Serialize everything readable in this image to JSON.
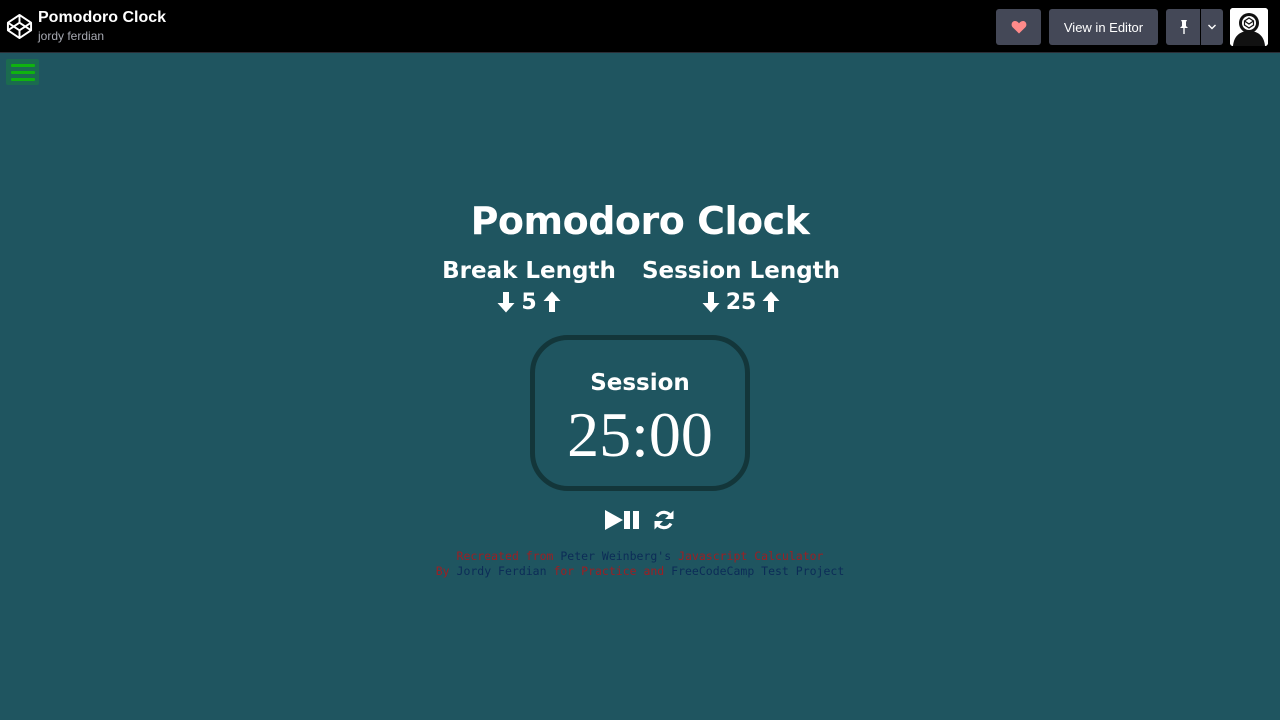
{
  "header": {
    "title": "Pomodoro Clock",
    "author": "jordy ferdian",
    "view_editor_label": "View in Editor"
  },
  "icons": {
    "logo": "codepen-logo-icon",
    "heart": "heart-icon",
    "pin": "pin-icon",
    "dropdown": "chevron-down-icon",
    "menu": "hamburger-menu-icon",
    "down": "arrow-down-icon",
    "up": "arrow-up-icon",
    "playpause": "play-pause-icon",
    "reset": "refresh-icon"
  },
  "colors": {
    "background": "#1f5560",
    "topbar": "#000000",
    "button": "#444857",
    "heart": "#ff8a8a",
    "timer_border": "#13363a",
    "credit_red": "#9c1f23",
    "credit_blue": "#0c2c57"
  },
  "clock": {
    "title": "Pomodoro Clock",
    "break_label": "Break Length",
    "break_value": "5",
    "session_label": "Session Length",
    "session_value": "25",
    "timer_label": "Session",
    "timer_value": "25:00"
  },
  "credits": {
    "line1": {
      "part1": "Recreated from ",
      "part2": "Peter Weinberg's",
      "part3": " Javascript Calculator"
    },
    "line2": {
      "part1": "By ",
      "part2": "Jordy Ferdian",
      "part3": " for Practice and ",
      "part4": "FreeCodeCamp Test Project"
    }
  }
}
